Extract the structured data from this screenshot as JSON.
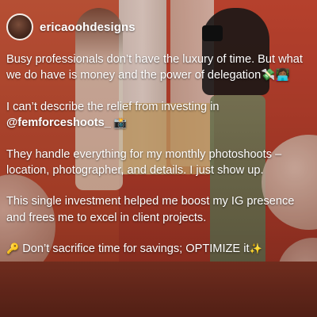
{
  "post": {
    "username": "ericaoohdesigns",
    "caption": {
      "p1": "Busy professionals don’t have the luxury of time. But what we do have is money and the power of delegation💸👩🏾‍💻",
      "p2_line1": "I can’t describe the relief from investing in",
      "p2_handle": "@femforceshoots_",
      "p2_emoji": "📸",
      "p3": "They handle everything for my monthly photoshoots – location, photographer, and details. I just show up.",
      "p4": "This single investment helped me boost my IG presence and frees me to excel in client projects.",
      "p5_icon": "🔑",
      "p5": "Don’t sacrifice time for savings; OPTIMIZE it",
      "p5_emoji": "✨"
    }
  },
  "colors": {
    "background_wall": "#b8452c",
    "text": "#ffffff"
  },
  "icons": {
    "avatar": "profile-avatar",
    "key": "key-icon",
    "sparkles": "sparkles-icon",
    "camera": "camera-flash-icon",
    "money": "money-with-wings-icon"
  }
}
